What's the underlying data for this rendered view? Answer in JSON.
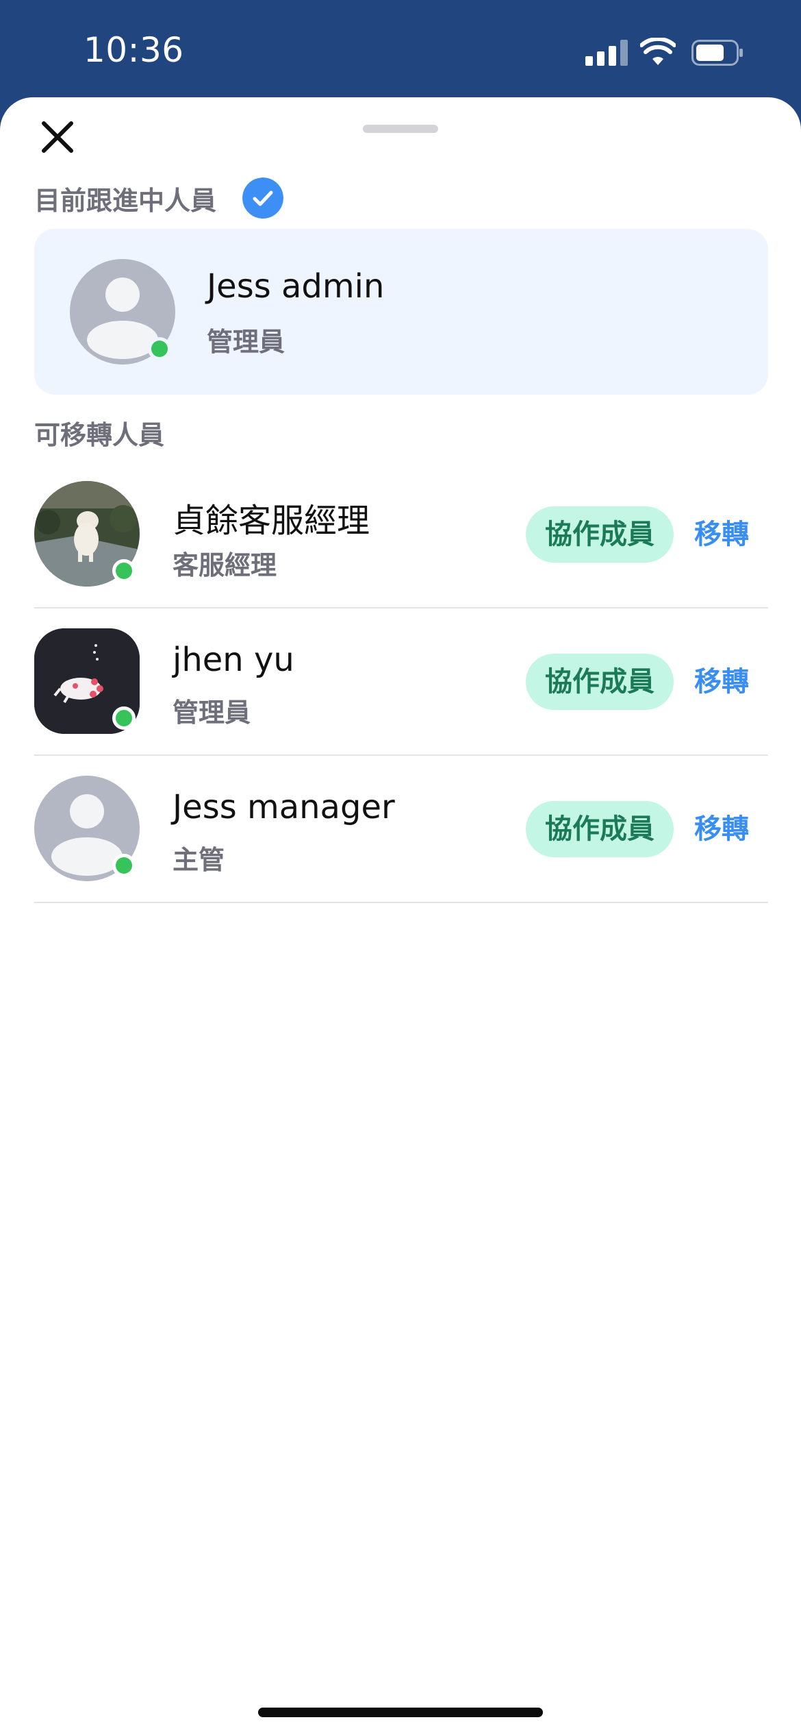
{
  "status_bar": {
    "time": "10:36"
  },
  "sheet": {
    "current_section": {
      "label": "目前跟進中人員",
      "person": {
        "name": "Jess admin",
        "role": "管理員",
        "online": true
      }
    },
    "transfer_section": {
      "label": "可移轉人員",
      "people": [
        {
          "name": "貞餘客服經理",
          "role": "客服經理",
          "badge": "協作成員",
          "action": "移轉",
          "avatar": "dog-photo"
        },
        {
          "name": "jhen yu",
          "role": "管理員",
          "badge": "協作成員",
          "action": "移轉",
          "avatar": "axolotl-illustration"
        },
        {
          "name": "Jess manager",
          "role": "主管",
          "badge": "協作成員",
          "action": "移轉",
          "avatar": "default-person"
        }
      ]
    }
  },
  "colors": {
    "header_blue": "#21457f",
    "accent_blue": "#3a8ef2",
    "online_green": "#36c45a",
    "badge_bg": "#c3f6e4",
    "badge_text": "#1c7a58",
    "card_bg": "#eef5ff"
  }
}
